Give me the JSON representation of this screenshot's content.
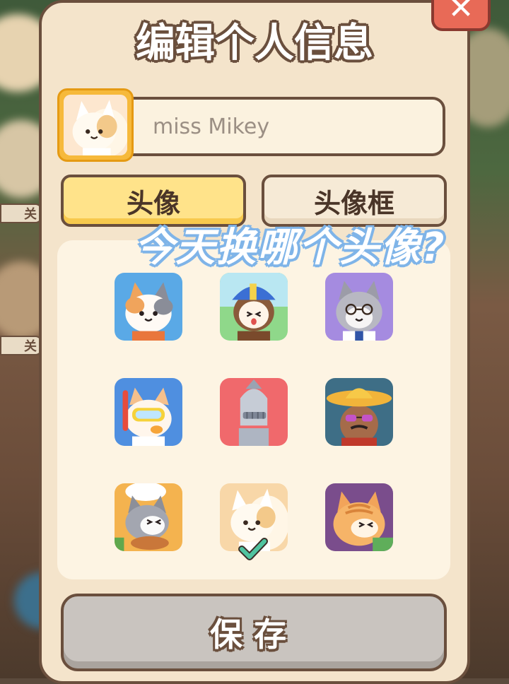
{
  "dialog": {
    "title": "编辑个人信息",
    "close_label": "✕"
  },
  "profile": {
    "name_value": "miss Mikey",
    "avatar_icon": "cat-avatar-icon"
  },
  "tabs": [
    {
      "label": "头像",
      "selected": true
    },
    {
      "label": "头像框",
      "selected": false
    }
  ],
  "overlay_caption": "今天换哪个头像?",
  "avatars": [
    {
      "icon": "calico-cat-icon",
      "bg": "#5aa9e6"
    },
    {
      "icon": "cap-monkey-icon",
      "bg": "#8fd88a"
    },
    {
      "icon": "gray-cat-glasses-icon",
      "bg": "#a58be0"
    },
    {
      "icon": "snorkel-cat-icon",
      "bg": "#4f8fe0"
    },
    {
      "icon": "knight-helmet-icon",
      "bg": "#f0696c"
    },
    {
      "icon": "sombrero-sunglasses-icon",
      "bg": "#3e6e86"
    },
    {
      "icon": "chef-cat-bread-icon",
      "bg": "#f4b34f"
    },
    {
      "icon": "cream-cat-icon",
      "bg": "#f8d7a8",
      "selected": true
    },
    {
      "icon": "orange-tabby-cat-icon",
      "bg": "#7a4d8c"
    }
  ],
  "save_label": "保存",
  "background_badges": [
    "关",
    "关"
  ],
  "colors": {
    "panel": "#f4e4cb",
    "outline": "#6a4f3d",
    "tab_selected": "#ffe38a",
    "close": "#e86a57",
    "check": "#4fc4a0"
  }
}
